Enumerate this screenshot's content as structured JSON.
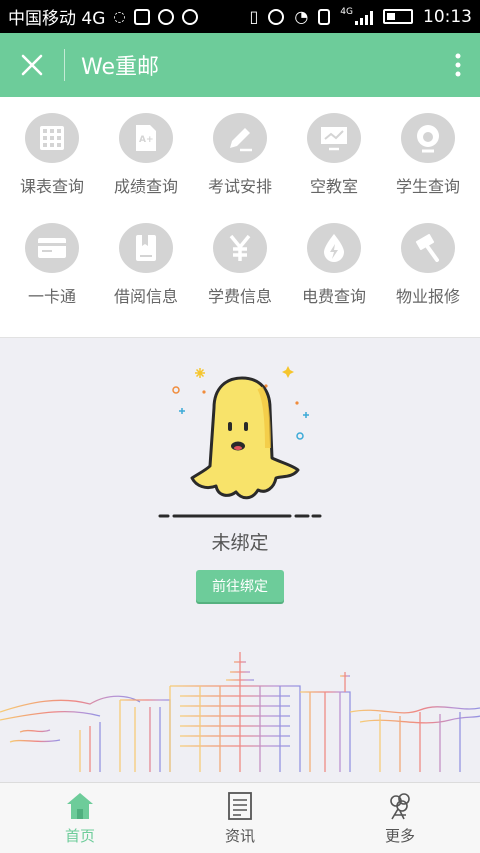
{
  "status_bar": {
    "carrier": "中国移动 4G",
    "network_badge": "4G",
    "time": "10:13"
  },
  "appbar": {
    "title": "We重邮",
    "close_icon": "close-icon",
    "more_icon": "more-vertical-icon"
  },
  "grid": {
    "items": [
      {
        "label": "课表查询",
        "icon": "timetable-icon"
      },
      {
        "label": "成绩查询",
        "icon": "grade-icon"
      },
      {
        "label": "考试安排",
        "icon": "exam-icon"
      },
      {
        "label": "空教室",
        "icon": "classroom-icon"
      },
      {
        "label": "学生查询",
        "icon": "student-icon"
      },
      {
        "label": "一卡通",
        "icon": "card-icon"
      },
      {
        "label": "借阅信息",
        "icon": "book-icon"
      },
      {
        "label": "学费信息",
        "icon": "yuan-icon"
      },
      {
        "label": "电费查询",
        "icon": "electricity-icon"
      },
      {
        "label": "物业报修",
        "icon": "hammer-icon"
      }
    ]
  },
  "content": {
    "status_text": "未绑定",
    "bind_button": "前往绑定"
  },
  "bottom_nav": {
    "items": [
      {
        "label": "首页",
        "icon": "home-icon",
        "active": true
      },
      {
        "label": "资讯",
        "icon": "news-icon",
        "active": false
      },
      {
        "label": "更多",
        "icon": "more-flower-icon",
        "active": false
      }
    ]
  },
  "colors": {
    "accent": "#6dcc9a",
    "icon_bg": "#d4d4d4",
    "content_bg": "#efeff4"
  }
}
